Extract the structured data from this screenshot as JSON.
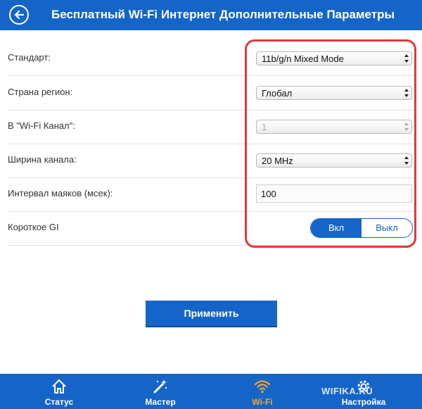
{
  "header": {
    "title": "Бесплатный Wi-Fi Интернет Дополнительные Параметры",
    "back_icon": "back-arrow-icon"
  },
  "settings": {
    "standard": {
      "label": "Стандарт:",
      "value": "11b/g/n Mixed Mode"
    },
    "region": {
      "label": "Страна регион:",
      "value": "Глобал"
    },
    "channel": {
      "label": "В \"Wi-Fi Канал\":",
      "value": "1",
      "disabled": true
    },
    "bandwidth": {
      "label": "Ширина канала:",
      "value": "20 MHz"
    },
    "beacon": {
      "label": "Интервал маяков (мсек):",
      "value": "100"
    },
    "short_gi": {
      "label": "Короткое GI",
      "on_label": "Вкл",
      "off_label": "Выкл",
      "selected": "on"
    }
  },
  "apply_label": "Применить",
  "nav": {
    "items": [
      {
        "label": "Статус",
        "icon": "home-icon",
        "active": false
      },
      {
        "label": "Мастер",
        "icon": "magic-wand-icon",
        "active": false
      },
      {
        "label": "Wi-Fi",
        "icon": "wifi-icon",
        "active": true
      },
      {
        "label": "Настройка",
        "icon": "gear-icon",
        "active": false
      }
    ]
  },
  "watermark": "WIFIKA.RU",
  "colors": {
    "primary": "#1565c9",
    "active_nav": "#f5a623",
    "highlight": "#e53935"
  }
}
